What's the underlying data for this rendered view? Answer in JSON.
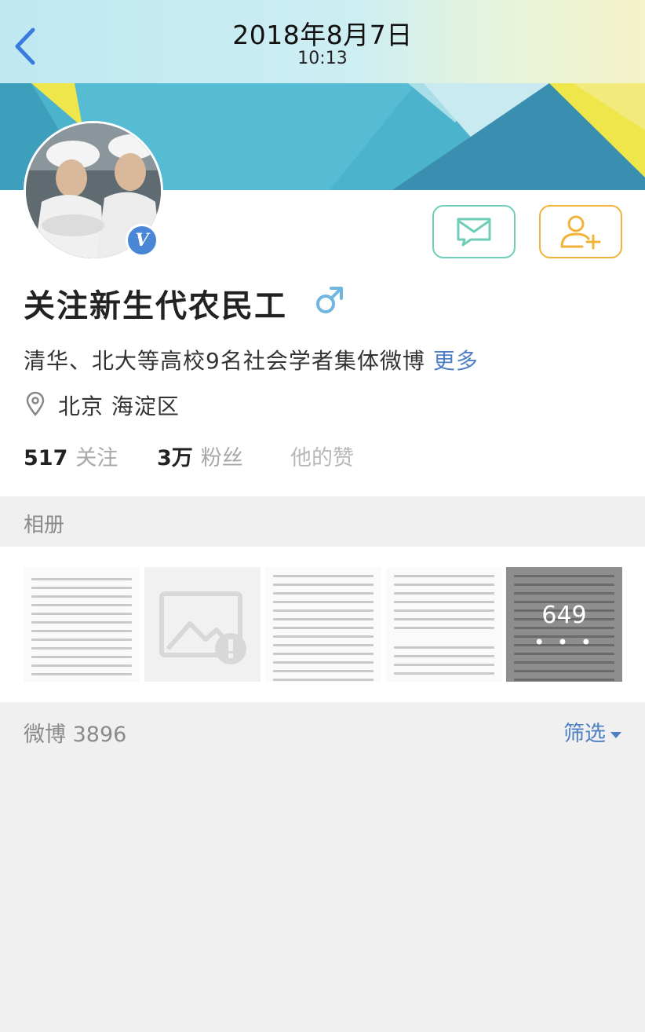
{
  "header": {
    "date": "2018年8月7日",
    "time": "10:13"
  },
  "profile": {
    "name": "关注新生代农民工",
    "gender_icon": "male-icon",
    "bio": "清华、北大等高校9名社会学者集体微博",
    "bio_more": "更多",
    "location": "北京 海淀区",
    "stats": {
      "following_count": "517",
      "following_label": "关注",
      "followers_count": "3万",
      "followers_label": "粉丝",
      "likes_label": "他的赞"
    }
  },
  "album": {
    "title": "相册",
    "photo_count": "649",
    "more_dots": "• • •"
  },
  "feed": {
    "label": "微博 3896",
    "filter_label": "筛选"
  },
  "colors": {
    "accent_blue": "#4f7fc5",
    "message_btn": "#6fcdb9",
    "follow_btn": "#f2b33a",
    "verified": "#4a86d6"
  }
}
